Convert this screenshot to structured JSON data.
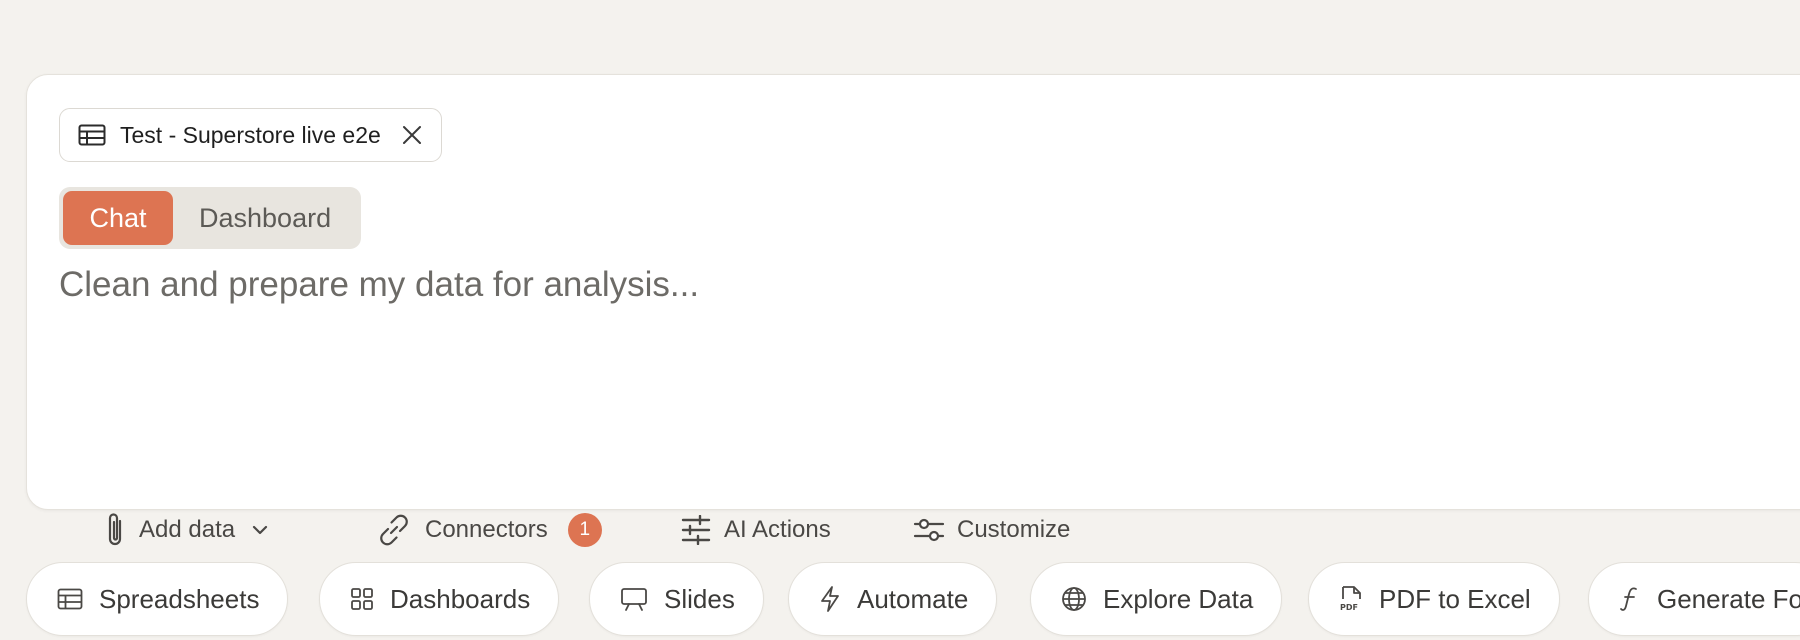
{
  "file_chip": {
    "label": "Test - Superstore live e2e",
    "icon": "table-icon",
    "close_icon": "close-icon"
  },
  "mode_toggle": {
    "options": [
      "Chat",
      "Dashboard"
    ],
    "selected": "Chat"
  },
  "prompt": {
    "placeholder": "Clean and prepare my data for analysis...",
    "value": ""
  },
  "toolbar": {
    "add_data": {
      "label": "Add data",
      "icon": "paperclip-icon",
      "caret_icon": "chevron-down-icon"
    },
    "connectors": {
      "label": "Connectors",
      "icon": "link-icon",
      "badge": "1"
    },
    "ai_actions": {
      "label": "AI Actions",
      "icon": "sliders-icon"
    },
    "customize": {
      "label": "Customize",
      "icon": "settings-sliders-icon"
    }
  },
  "quick_actions": [
    {
      "label": "Spreadsheets",
      "icon": "spreadsheet-icon"
    },
    {
      "label": "Dashboards",
      "icon": "grid-icon"
    },
    {
      "label": "Slides",
      "icon": "presentation-icon"
    },
    {
      "label": "Automate",
      "icon": "lightning-icon"
    },
    {
      "label": "Explore Data",
      "icon": "globe-icon"
    },
    {
      "label": "PDF to Excel",
      "icon": "pdf-file-icon"
    },
    {
      "label": "Generate Fo",
      "icon": "function-icon"
    }
  ],
  "colors": {
    "background": "#f4f2ee",
    "accent": "#dd7452",
    "card": "#ffffff",
    "toggle_track": "#e8e5df"
  }
}
